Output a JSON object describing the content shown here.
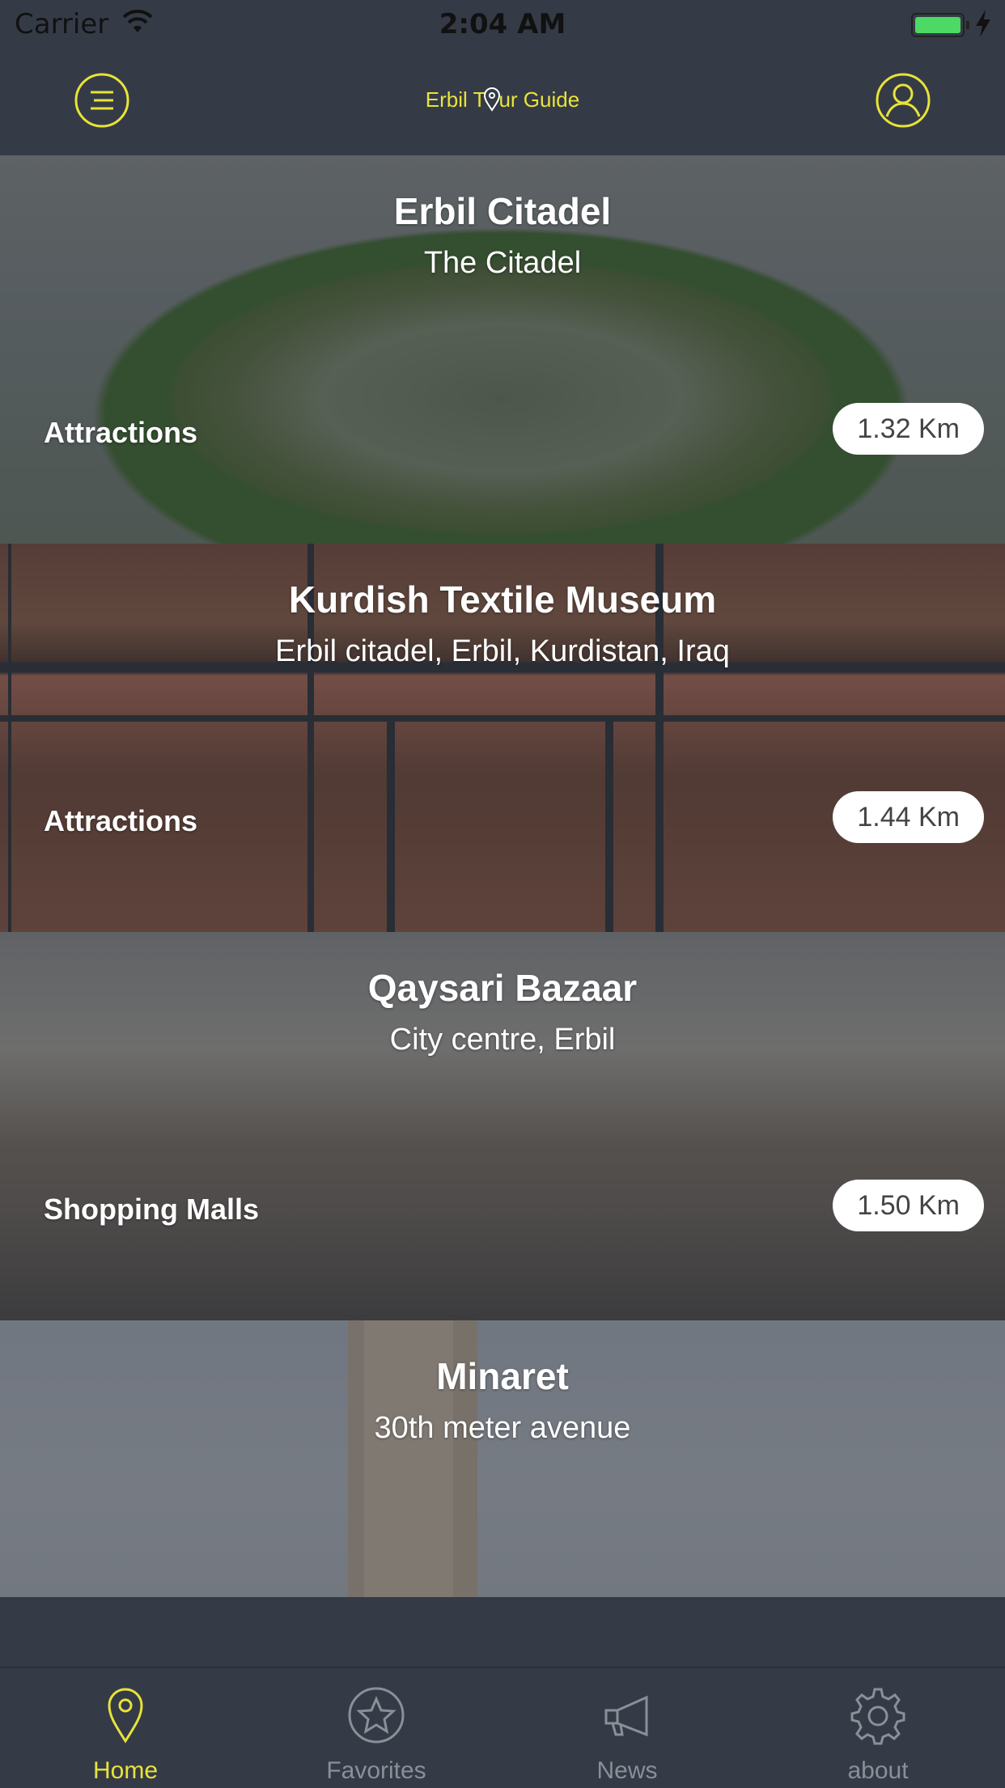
{
  "status_bar": {
    "carrier": "Carrier",
    "time": "2:04 AM"
  },
  "nav": {
    "title_before": "Erbil T",
    "title_after": "ur Guide",
    "accent": "#e8e33a",
    "menu_icon": "menu-icon",
    "profile_icon": "user-icon"
  },
  "places": [
    {
      "title": "Erbil Citadel",
      "subtitle": "The Citadel",
      "category": "Attractions",
      "distance": "1.32 Km"
    },
    {
      "title": "Kurdish Textile Museum",
      "subtitle": "Erbil citadel, Erbil, Kurdistan, Iraq",
      "category": "Attractions",
      "distance": "1.44 Km"
    },
    {
      "title": "Qaysari Bazaar",
      "subtitle": "City centre, Erbil",
      "category": "Shopping Malls",
      "distance": "1.50 Km"
    },
    {
      "title": "Minaret",
      "subtitle": "30th meter avenue"
    }
  ],
  "tabs": [
    {
      "label": "Home",
      "icon": "map-pin-icon",
      "active": true
    },
    {
      "label": "Favorites",
      "icon": "star-icon",
      "active": false
    },
    {
      "label": "News",
      "icon": "megaphone-icon",
      "active": false
    },
    {
      "label": "about",
      "icon": "gear-icon",
      "active": false
    }
  ],
  "colors": {
    "background": "#353b46",
    "accent": "#e8e33a",
    "inactive": "#8a8f98"
  }
}
